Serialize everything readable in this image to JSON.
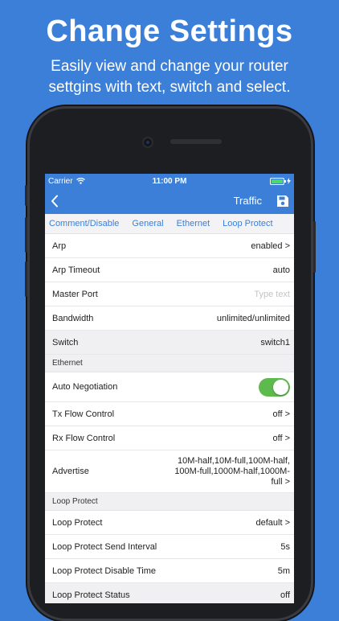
{
  "promo": {
    "headline": "Change Settings",
    "subline_1": "Easily view and change your router",
    "subline_2": "settgins with text, switch and select."
  },
  "status_bar": {
    "carrier": "Carrier",
    "time": "11:00 PM"
  },
  "nav": {
    "title": "Traffic",
    "back_icon": "chevron-left-icon",
    "save_icon": "floppy-disk-icon"
  },
  "tabs": [
    "Comment/Disable",
    "General",
    "Ethernet",
    "Loop Protect"
  ],
  "rows_top": [
    {
      "label": "Arp",
      "value": "enabled >"
    },
    {
      "label": "Arp Timeout",
      "value": "auto"
    },
    {
      "label": "Master Port",
      "placeholder": "Type text"
    },
    {
      "label": "Bandwidth",
      "value": "unlimited/unlimited"
    },
    {
      "label": "Switch",
      "value": "switch1"
    }
  ],
  "section_ethernet": "Ethernet",
  "auto_negotiation": {
    "label": "Auto Negotiation",
    "on": true
  },
  "rows_ethernet": [
    {
      "label": "Tx Flow Control",
      "value": "off >"
    },
    {
      "label": "Rx Flow Control",
      "value": "off >"
    }
  ],
  "advertise": {
    "label": "Advertise",
    "value": "10M-half,10M-full,100M-half, 100M-full,1000M-half,1000M- full >"
  },
  "section_loop": "Loop Protect",
  "rows_loop": [
    {
      "label": "Loop Protect",
      "value": "default >"
    },
    {
      "label": "Loop Protect Send Interval",
      "value": "5s"
    },
    {
      "label": "Loop Protect Disable Time",
      "value": "5m"
    },
    {
      "label": "Loop Protect Status",
      "value": "off"
    }
  ],
  "colors": {
    "accent": "#3b7fd9",
    "toggle_on": "#5fba4e"
  }
}
